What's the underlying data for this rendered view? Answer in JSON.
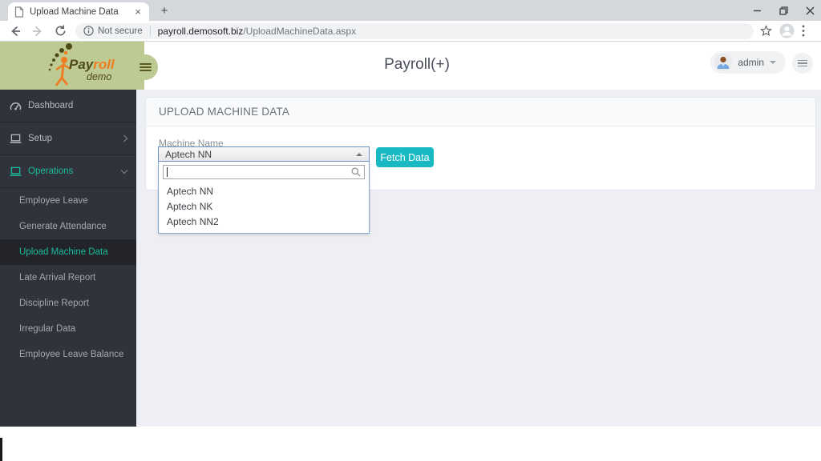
{
  "browser": {
    "tab_title": "Upload Machine Data",
    "tab_close": "×",
    "new_tab": "+",
    "security_label": "Not secure",
    "url_domain": "payroll.demosoft.biz",
    "url_path": "/UploadMachineData.aspx"
  },
  "header": {
    "app_title": "Payroll(+)",
    "logo_pay": "Pay",
    "logo_roll": "roll",
    "logo_demo": "demo",
    "user_label": "admin"
  },
  "sidebar": {
    "dashboard": "Dashboard",
    "setup": "Setup",
    "operations": "Operations",
    "submenu": [
      "Employee Leave",
      "Generate Attendance",
      "Upload Machine Data",
      "Late Arrival Report",
      "Discipline Report",
      "Irregular Data",
      "Employee Leave Balance"
    ],
    "active_item": "Upload Machine Data"
  },
  "main": {
    "panel_title": "UPLOAD MACHINE DATA",
    "machine_label": "Machine Name",
    "select_value": "Aptech NN",
    "search_value": "",
    "options": [
      "Aptech NN",
      "Aptech NK",
      "Aptech NN2"
    ],
    "fetch_label": "Fetch Data"
  },
  "colors": {
    "accent_teal": "#1abb9c",
    "button_teal": "#18b9c2",
    "logo_green": "#bdca92",
    "logo_orange": "#ef7e23",
    "logo_olive": "#4f4c17",
    "sidebar_bg": "#30333b",
    "sidebar_active_bg": "#222429",
    "content_bg": "#edeff4",
    "dropdown_border_blue": "#86a8d3"
  }
}
